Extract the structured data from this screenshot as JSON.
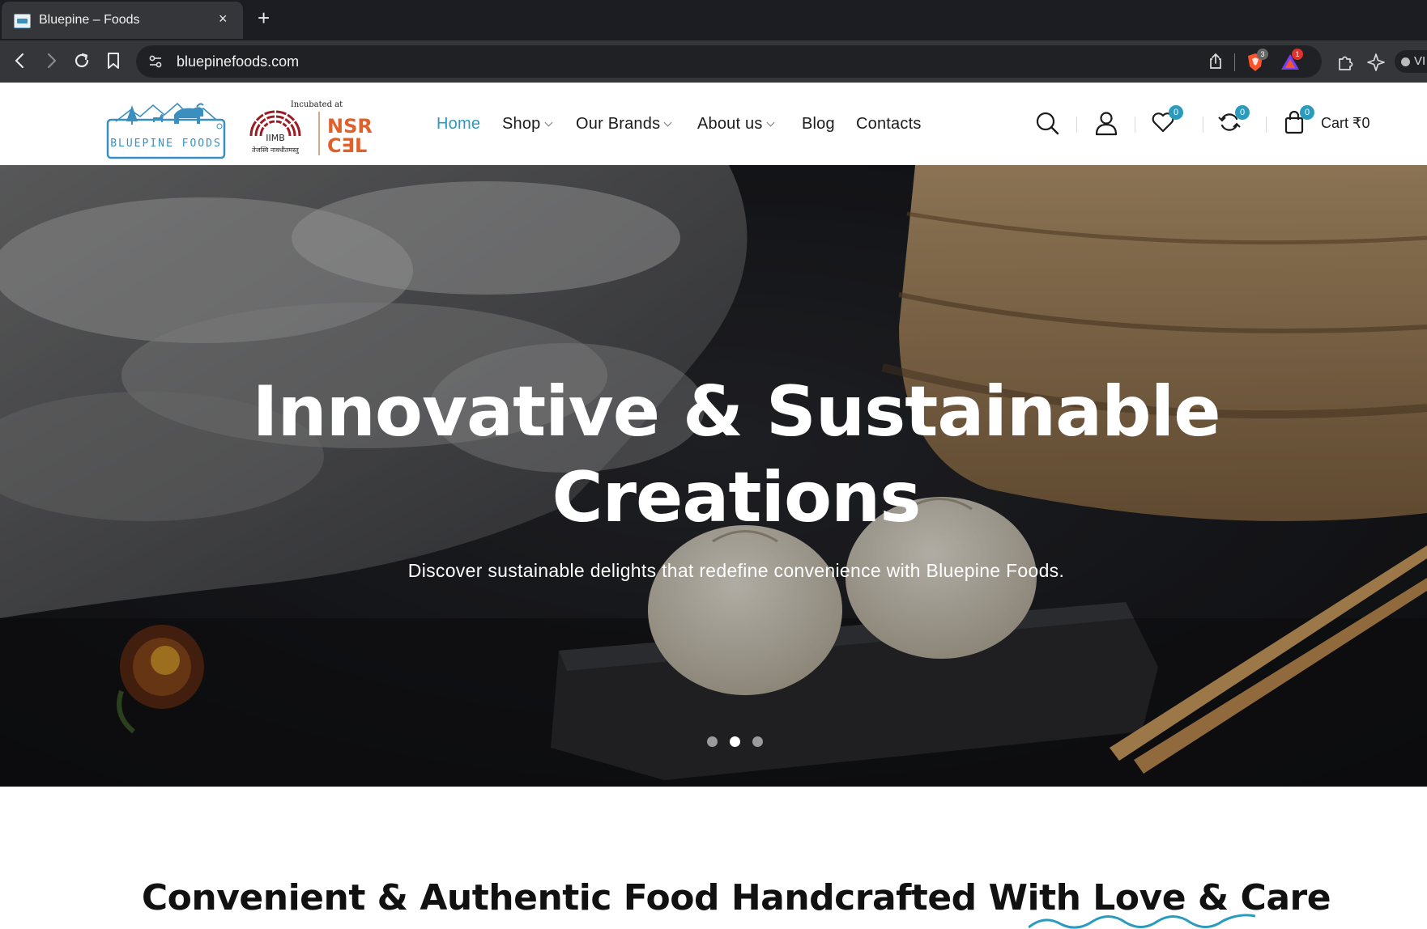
{
  "browser": {
    "tab_title": "Bluepine – Foods",
    "tab_close": "×",
    "new_tab": "+",
    "url": "bluepinefoods.com",
    "brave_badge": "3",
    "rewards_badge": "1",
    "profile_label": "VI"
  },
  "header": {
    "logo_text": "BLUEPINE FOODS",
    "incubated_text": "Incubated at",
    "iimb_text": "IIMB",
    "iimb_motto": "तेजस्वि नावधीतमस्तु",
    "nsrcel_line1": "NSR",
    "nsrcel_line2": "C∃L",
    "nav": [
      {
        "label": "Home",
        "active": true
      },
      {
        "label": "Shop",
        "dropdown": true
      },
      {
        "label": "Our Brands",
        "dropdown": true
      },
      {
        "label": "About us",
        "dropdown": true
      },
      {
        "label": "Blog"
      },
      {
        "label": "Contacts"
      }
    ],
    "wishlist_count": "0",
    "compare_count": "0",
    "cart_count": "0",
    "cart_label": "Cart ₹0",
    "accent_color": "#2b9bbd"
  },
  "hero": {
    "title_line1": "Innovative & Sustainable",
    "title_line2": "Creations",
    "subtitle": "Discover sustainable delights that redefine convenience with Bluepine Foods.",
    "slides": 3,
    "active_slide": 2
  },
  "section": {
    "heading": "Convenient & Authentic Food Handcrafted With Love & Care"
  }
}
